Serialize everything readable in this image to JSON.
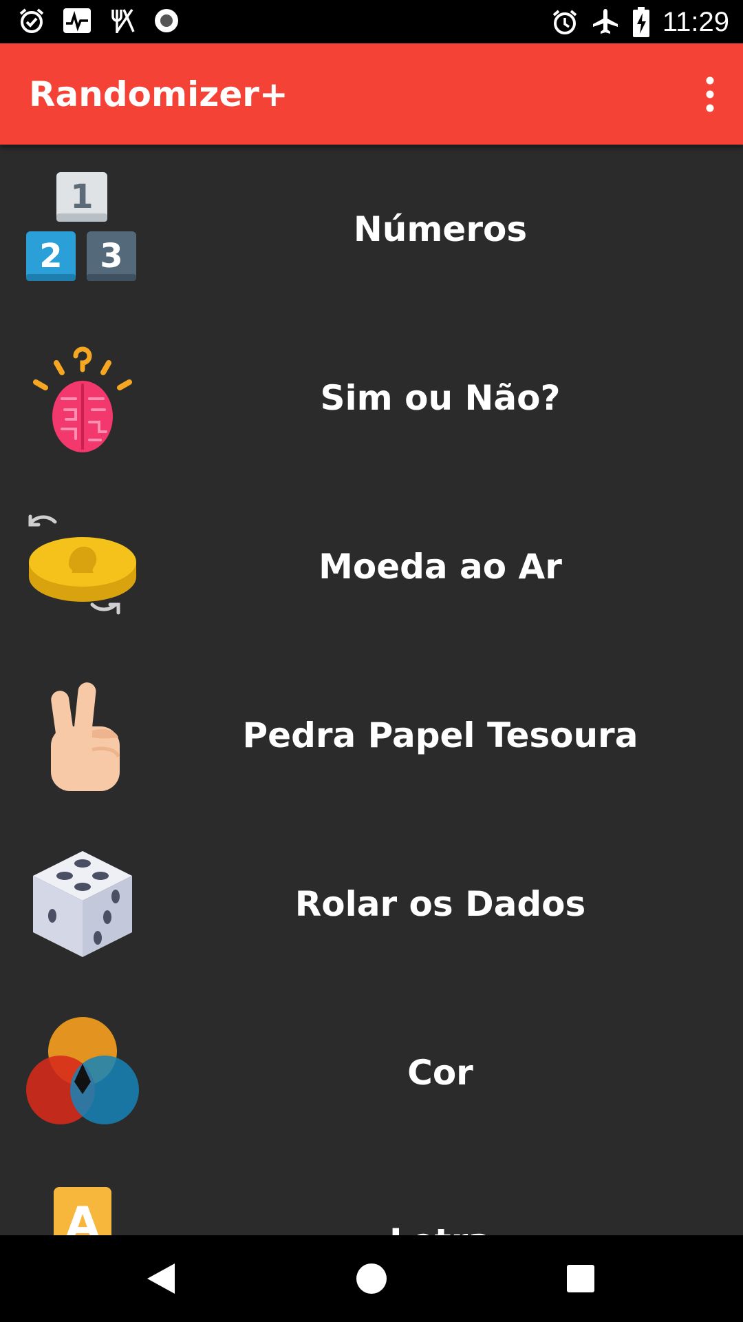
{
  "status_bar": {
    "time": "11:29",
    "left_icons": [
      "alarm-check-icon",
      "activity-monitor-icon",
      "restaurant-icon",
      "record-icon"
    ],
    "right_icons": [
      "alarm-icon",
      "airplane-mode-icon",
      "battery-charging-icon"
    ]
  },
  "app_bar": {
    "title": "Randomizer+",
    "background_color": "#f44336",
    "menu_icon": "more-vert-icon"
  },
  "menu": {
    "items": [
      {
        "label": "Números",
        "icon": "numbers-123-icon"
      },
      {
        "label": "Sim ou Não?",
        "icon": "brain-icon"
      },
      {
        "label": "Moeda ao Ar",
        "icon": "coin-flip-icon"
      },
      {
        "label": "Pedra Papel Tesoura",
        "icon": "victory-hand-icon"
      },
      {
        "label": "Rolar os Dados",
        "icon": "dice-icon"
      },
      {
        "label": "Cor",
        "icon": "color-circles-icon"
      },
      {
        "label": "Letra",
        "icon": "letter-a-icon"
      }
    ]
  },
  "nav_bar": {
    "buttons": [
      "back-icon",
      "home-icon",
      "recents-icon"
    ]
  },
  "colors": {
    "background": "#2b2b2b",
    "accent": "#f44336",
    "text": "#ffffff"
  }
}
